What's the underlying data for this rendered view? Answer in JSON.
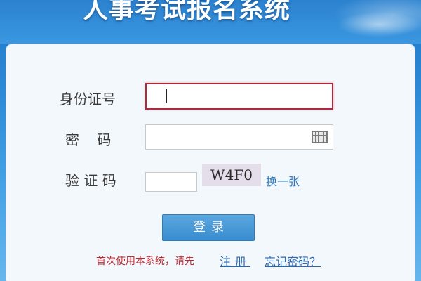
{
  "header": {
    "title": "人事考试报名系统"
  },
  "form": {
    "id_label": "身份证号",
    "password_label": "密    码",
    "captcha_label": "验 证 码",
    "captcha_text": "W4F0",
    "refresh_captcha": "换一张",
    "keyboard_icon": "keyboard-icon"
  },
  "actions": {
    "login": "登录"
  },
  "footer": {
    "note": "首次使用本系统，请先",
    "register": "注册",
    "forgot": "忘记密码？"
  },
  "colors": {
    "accent_blue": "#3a8ccf",
    "focus_red": "#b0283a",
    "note_red": "#c0282f",
    "link_blue": "#2a66b0"
  }
}
